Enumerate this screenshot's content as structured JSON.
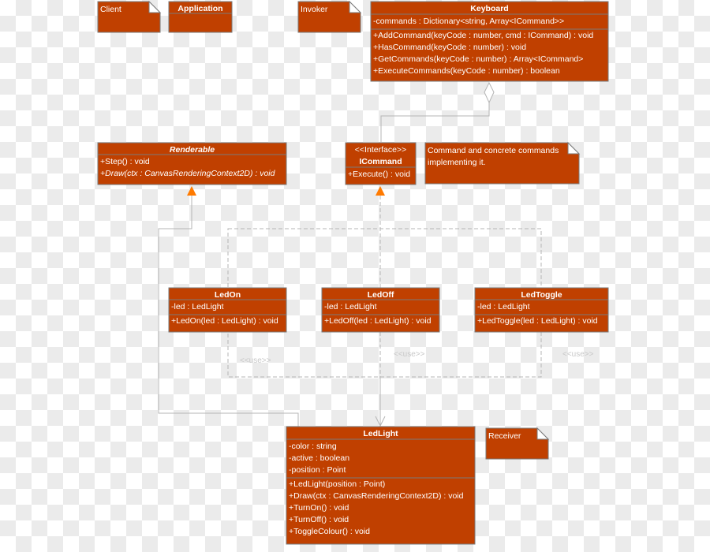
{
  "colors": {
    "box_fill": "#c04000",
    "box_border": "#7a7a7a",
    "line": "#b4b4b4",
    "arrowhead": "#ff7a00"
  },
  "notes": {
    "client": "Client",
    "invoker": "Invoker",
    "command_note": [
      "Command and concrete commands",
      "implementing it."
    ],
    "receiver": "Receiver"
  },
  "classes": {
    "application": {
      "name": "Application",
      "attributes": [],
      "methods": []
    },
    "keyboard": {
      "name": "Keyboard",
      "attributes": [
        "-commands : Dictionary<string, Array<ICommand>>"
      ],
      "methods": [
        "+AddCommand(keyCode : number, cmd : ICommand) : void",
        "+HasCommand(keyCode : number) : void",
        "+GetCommands(keyCode : number) : Array<ICommand>",
        "+ExecuteCommands(keyCode : number) : boolean"
      ]
    },
    "renderable": {
      "name": "Renderable",
      "abstract": true,
      "attributes": [],
      "methods": [
        "+Step() : void",
        "+Draw(ctx : CanvasRenderingContext2D) : void"
      ]
    },
    "icommand": {
      "stereotype": "<<Interface>>",
      "name": "ICommand",
      "attributes": [],
      "methods": [
        "+Execute() : void"
      ]
    },
    "ledon": {
      "name": "LedOn",
      "attributes": [
        "-led : LedLight"
      ],
      "methods": [
        "+LedOn(led : LedLight) : void"
      ]
    },
    "ledoff": {
      "name": "LedOff",
      "attributes": [
        "-led : LedLight"
      ],
      "methods": [
        "+LedOff(led : LedLight) : void"
      ]
    },
    "ledtoggle": {
      "name": "LedToggle",
      "attributes": [
        "-led : LedLight"
      ],
      "methods": [
        "+LedToggle(led : LedLight) : void"
      ]
    },
    "ledlight": {
      "name": "LedLight",
      "attributes": [
        "-color : string",
        "-active : boolean",
        "-position : Point"
      ],
      "methods": [
        "+LedLight(position : Point)",
        "+Draw(ctx : CanvasRenderingContext2D) : void",
        "+TurnOn() : void",
        "+TurnOff() : void",
        "+ToggleColour() : void"
      ]
    }
  },
  "use_labels": [
    "<<use>>",
    "<<use>>",
    "<<use>>"
  ]
}
